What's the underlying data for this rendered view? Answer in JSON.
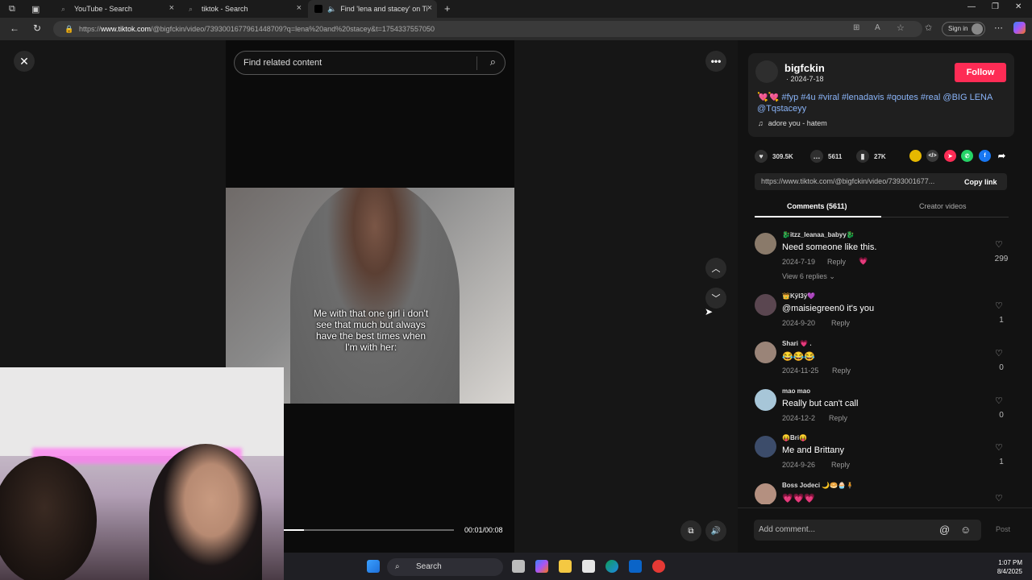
{
  "browser": {
    "tabs": [
      {
        "label": "YouTube - Search"
      },
      {
        "label": "tiktok - Search"
      },
      {
        "label": "Find 'lena and stacey' on Tik"
      }
    ],
    "url_prefix": "https://",
    "url_domain": "www.tiktok.com",
    "url_rest": "/@bigfckin/video/7393001677961448709?q=lena%20and%20stacey&t=1754337557050",
    "sign_in_label": "Sign in"
  },
  "player": {
    "search_placeholder": "Find related content",
    "caption": "Me with that one girl i don't see that much but always have the best times when I'm with her:",
    "time": "00:01/00:08",
    "progress_fraction": 0.12
  },
  "author": {
    "username": "bigfckin",
    "date": "· 2024-7-18",
    "follow_label": "Follow",
    "description": "💘💘 #fyp #4u #viral #lenadavis #qoutes #real @BIG LENA @Tqstaceyy",
    "music": "adore you - hatem"
  },
  "stats": {
    "likes": "309.5K",
    "comments": "5611",
    "saves": "27K"
  },
  "share": {
    "link": "https://www.tiktok.com/@bigfckin/video/7393001677...",
    "copy_label": "Copy link"
  },
  "tabs": {
    "comments_label": "Comments (5611)",
    "creator_label": "Creator videos"
  },
  "comments": [
    {
      "user": "🐉itzz_leanaa_babyy🐉",
      "text": "Need someone like this.",
      "date": "2024-7-19",
      "reply": "Reply",
      "likes": "299",
      "avatar_color": "#8a7a6a"
    },
    {
      "user": "👑Kÿl3ÿ💜",
      "text": "@maisiegreen0 it's you",
      "date": "2024-9-20",
      "reply": "Reply",
      "likes": "1",
      "avatar_color": "#5a4650"
    },
    {
      "user": "Shari 💗 .",
      "text": "😂😂😂",
      "date": "2024-11-25",
      "reply": "Reply",
      "likes": "0",
      "avatar_color": "#9a8478"
    },
    {
      "user": "mao mao",
      "text": "Really but can't call",
      "date": "2024-12-2",
      "reply": "Reply",
      "likes": "0",
      "avatar_color": "#a7c6d8"
    },
    {
      "user": "😝Bri😝",
      "text": "Me and Brittany",
      "date": "2024-9-26",
      "reply": "Reply",
      "likes": "1",
      "avatar_color": "#3c4c6a"
    },
    {
      "user": "Boss Jodeci 🌙🥯🧁🧍",
      "text": "💗💗💗",
      "date": "",
      "reply": "",
      "likes": "",
      "avatar_color": "#b49080"
    }
  ],
  "view_replies": "View 6 replies",
  "add_comment_placeholder": "Add comment...",
  "post_label": "Post",
  "taskbar": {
    "search_label": "Search",
    "time": "1:07 PM",
    "date": "8/4/2025"
  }
}
